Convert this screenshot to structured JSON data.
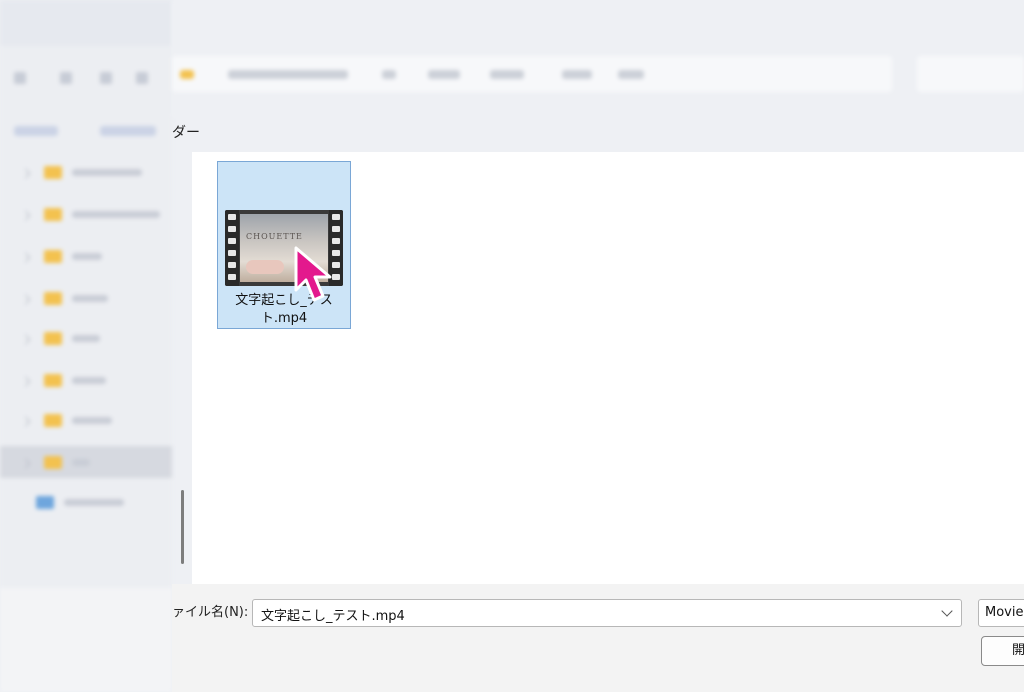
{
  "breadcrumb": {
    "text": "ダー"
  },
  "file_item": {
    "name": "文字起こし_テスト.mp4",
    "thumbnail_text": "CHOUETTE"
  },
  "bottom": {
    "filename_label": "ァイル名(N):",
    "filename_value": "文字起こし_テスト.mp4",
    "file_type_filter": "Movie",
    "open_button": "開"
  },
  "colors": {
    "selection_bg": "#cce4f7",
    "selection_border": "#7aa7d6",
    "cursor": "#e3198d",
    "folder": "#f3c24f"
  }
}
